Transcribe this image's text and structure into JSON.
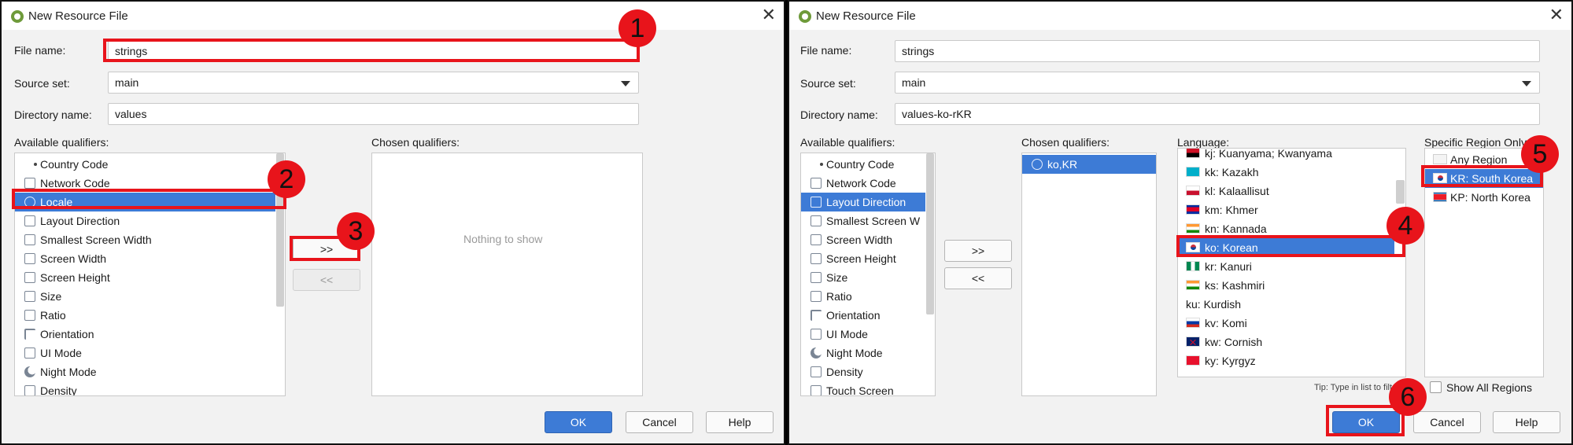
{
  "dialog_left": {
    "title": "New Resource File",
    "file_name_label": "File name:",
    "file_name_value": "strings",
    "source_set_label": "Source set:",
    "source_set_value": "main",
    "directory_name_label": "Directory name:",
    "directory_name_value": "values",
    "available_label": "Available qualifiers:",
    "chosen_label": "Chosen qualifiers:",
    "available_items": [
      "Country Code",
      "Network Code",
      "Locale",
      "Layout Direction",
      "Smallest Screen Width",
      "Screen Width",
      "Screen Height",
      "Size",
      "Ratio",
      "Orientation",
      "UI Mode",
      "Night Mode",
      "Density"
    ],
    "chosen_empty_text": "Nothing to show",
    "add_button": ">>",
    "remove_button": "<<",
    "ok": "OK",
    "cancel": "Cancel",
    "help": "Help"
  },
  "dialog_right": {
    "title": "New Resource File",
    "file_name_label": "File name:",
    "file_name_value": "strings",
    "source_set_label": "Source set:",
    "source_set_value": "main",
    "directory_name_label": "Directory name:",
    "directory_name_value": "values-ko-rKR",
    "available_label": "Available qualifiers:",
    "chosen_label": "Chosen qualifiers:",
    "language_label": "Language:",
    "region_label": "Specific Region Only:",
    "available_items": [
      "Country Code",
      "Network Code",
      "Layout Direction",
      "Smallest Screen W",
      "Screen Width",
      "Screen Height",
      "Size",
      "Ratio",
      "Orientation",
      "UI Mode",
      "Night Mode",
      "Density",
      "Touch Screen"
    ],
    "chosen_items": [
      "ko,KR"
    ],
    "languages": [
      "kj: Kuanyama; Kwanyama",
      "kk: Kazakh",
      "kl: Kalaallisut",
      "km: Khmer",
      "kn: Kannada",
      "ko: Korean",
      "kr: Kanuri",
      "ks: Kashmiri",
      "ku: Kurdish",
      "kv: Komi",
      "kw: Cornish",
      "ky: Kyrgyz"
    ],
    "regions": [
      "Any Region",
      "KR: South Korea",
      "KP: North Korea"
    ],
    "tip": "Tip: Type in list to filter",
    "show_all_regions": "Show All Regions",
    "add_button": ">>",
    "remove_button": "<<",
    "ok": "OK",
    "cancel": "Cancel",
    "help": "Help"
  },
  "step_badges": [
    "1",
    "2",
    "3",
    "4",
    "5",
    "6"
  ],
  "colors": {
    "selection": "#3d7bd6",
    "highlight": "#e8141b",
    "dialog_bg": "#f2f2f2"
  }
}
